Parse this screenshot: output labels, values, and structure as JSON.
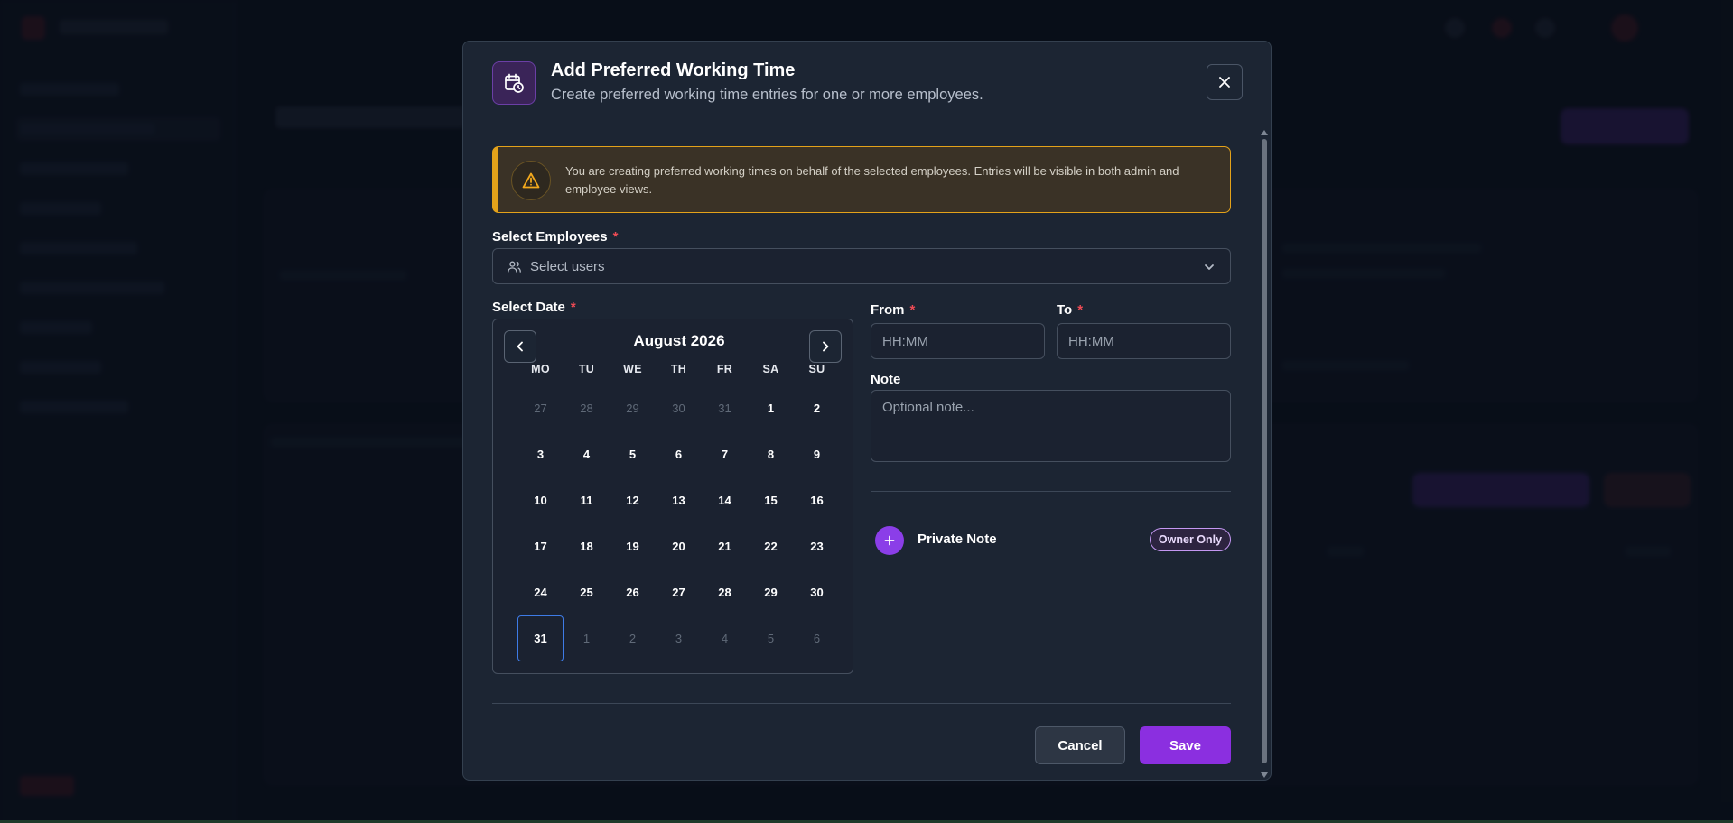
{
  "modal": {
    "title": "Add Preferred Working Time",
    "subtitle": "Create preferred working time entries for one or more employees.",
    "warning": "You are creating preferred working times on behalf of the selected employees. Entries will be visible in both admin and employee views.",
    "employees": {
      "label": "Select Employees",
      "required_mark": "*",
      "placeholder": "Select users"
    },
    "date": {
      "label": "Select Date",
      "required_mark": "*"
    },
    "calendar": {
      "month_label": "August 2026",
      "weekdays": [
        "MO",
        "TU",
        "WE",
        "TH",
        "FR",
        "SA",
        "SU"
      ],
      "weeks": [
        [
          "27",
          "28",
          "29",
          "30",
          "31",
          "1",
          "2"
        ],
        [
          "3",
          "4",
          "5",
          "6",
          "7",
          "8",
          "9"
        ],
        [
          "10",
          "11",
          "12",
          "13",
          "14",
          "15",
          "16"
        ],
        [
          "17",
          "18",
          "19",
          "20",
          "21",
          "22",
          "23"
        ],
        [
          "24",
          "25",
          "26",
          "27",
          "28",
          "29",
          "30"
        ],
        [
          "31",
          "1",
          "2",
          "3",
          "4",
          "5",
          "6"
        ]
      ],
      "selected_day": "31"
    },
    "from": {
      "label": "From",
      "required_mark": "*",
      "placeholder": "HH:MM",
      "value": ""
    },
    "to": {
      "label": "To",
      "required_mark": "*",
      "placeholder": "HH:MM",
      "value": ""
    },
    "note": {
      "label": "Note",
      "placeholder": "Optional note...",
      "value": ""
    },
    "private_note": {
      "label": "Private Note",
      "badge": "Owner Only"
    },
    "buttons": {
      "cancel": "Cancel",
      "save": "Save"
    }
  },
  "colors": {
    "accent": "#8b2fe0",
    "warning": "#e3a21a",
    "required": "#ef4b55",
    "selected_day_border": "#3e7be6"
  },
  "icons": {
    "header": "calendar-clock-icon",
    "close": "close-icon",
    "warning": "warning-triangle-icon",
    "users": "users-icon",
    "chevron": "chevron-down-icon",
    "prev": "chevron-left-icon",
    "next": "chevron-right-icon",
    "plus": "plus-icon"
  }
}
